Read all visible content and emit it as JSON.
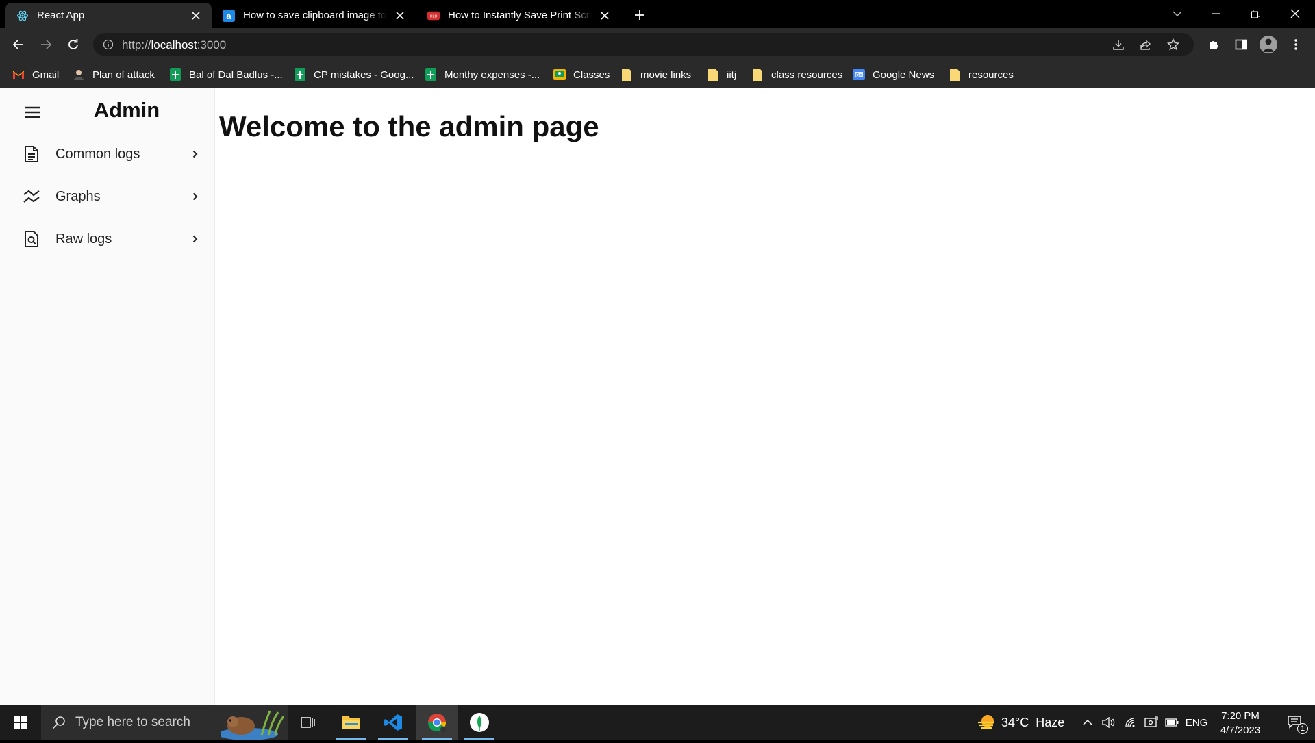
{
  "browser": {
    "tabs": [
      {
        "title": "React App",
        "favicon": "react-icon",
        "active": true
      },
      {
        "title": "How to save clipboard image to file",
        "favicon": "a-icon",
        "active": false
      },
      {
        "title": "How to Instantly Save Print Screen",
        "favicon": "video-icon",
        "active": false
      }
    ],
    "address": {
      "scheme": "http://",
      "host": "localhost",
      "port": ":3000"
    },
    "bookmarks": [
      {
        "label": "Gmail",
        "icon": "gmail-icon"
      },
      {
        "label": "Plan of attack",
        "icon": "avatar-icon"
      },
      {
        "label": "Bal of Dal Badlus -...",
        "icon": "sheets-icon"
      },
      {
        "label": "CP mistakes - Goog...",
        "icon": "sheets-icon"
      },
      {
        "label": "Monthy expenses -...",
        "icon": "sheets-icon"
      },
      {
        "label": "Classes",
        "icon": "classroom-icon"
      },
      {
        "label": "movie links",
        "icon": "folder-icon"
      },
      {
        "label": "iitj",
        "icon": "folder-icon"
      },
      {
        "label": "class resources",
        "icon": "folder-icon"
      },
      {
        "label": "Google News",
        "icon": "news-icon"
      },
      {
        "label": "resources",
        "icon": "folder-icon"
      }
    ]
  },
  "app": {
    "title": "Admin",
    "heading": "Welcome to the admin page",
    "nav": [
      {
        "label": "Common logs",
        "icon": "document-icon"
      },
      {
        "label": "Graphs",
        "icon": "graph-icon"
      },
      {
        "label": "Raw logs",
        "icon": "search-document-icon"
      }
    ]
  },
  "taskbar": {
    "search_placeholder": "Type here to search",
    "weather": {
      "temp": "34°C",
      "condition": "Haze"
    },
    "language": "ENG",
    "time": "7:20 PM",
    "date": "4/7/2023",
    "notifications": "1"
  },
  "colors": {
    "tab_bg": "#000000",
    "toolbar_bg": "#2a2a2a",
    "sidebar_bg": "#fafafa",
    "taskbar_bg": "#1c1c1c",
    "taskbar_active_indicator": "#76b9ed"
  }
}
